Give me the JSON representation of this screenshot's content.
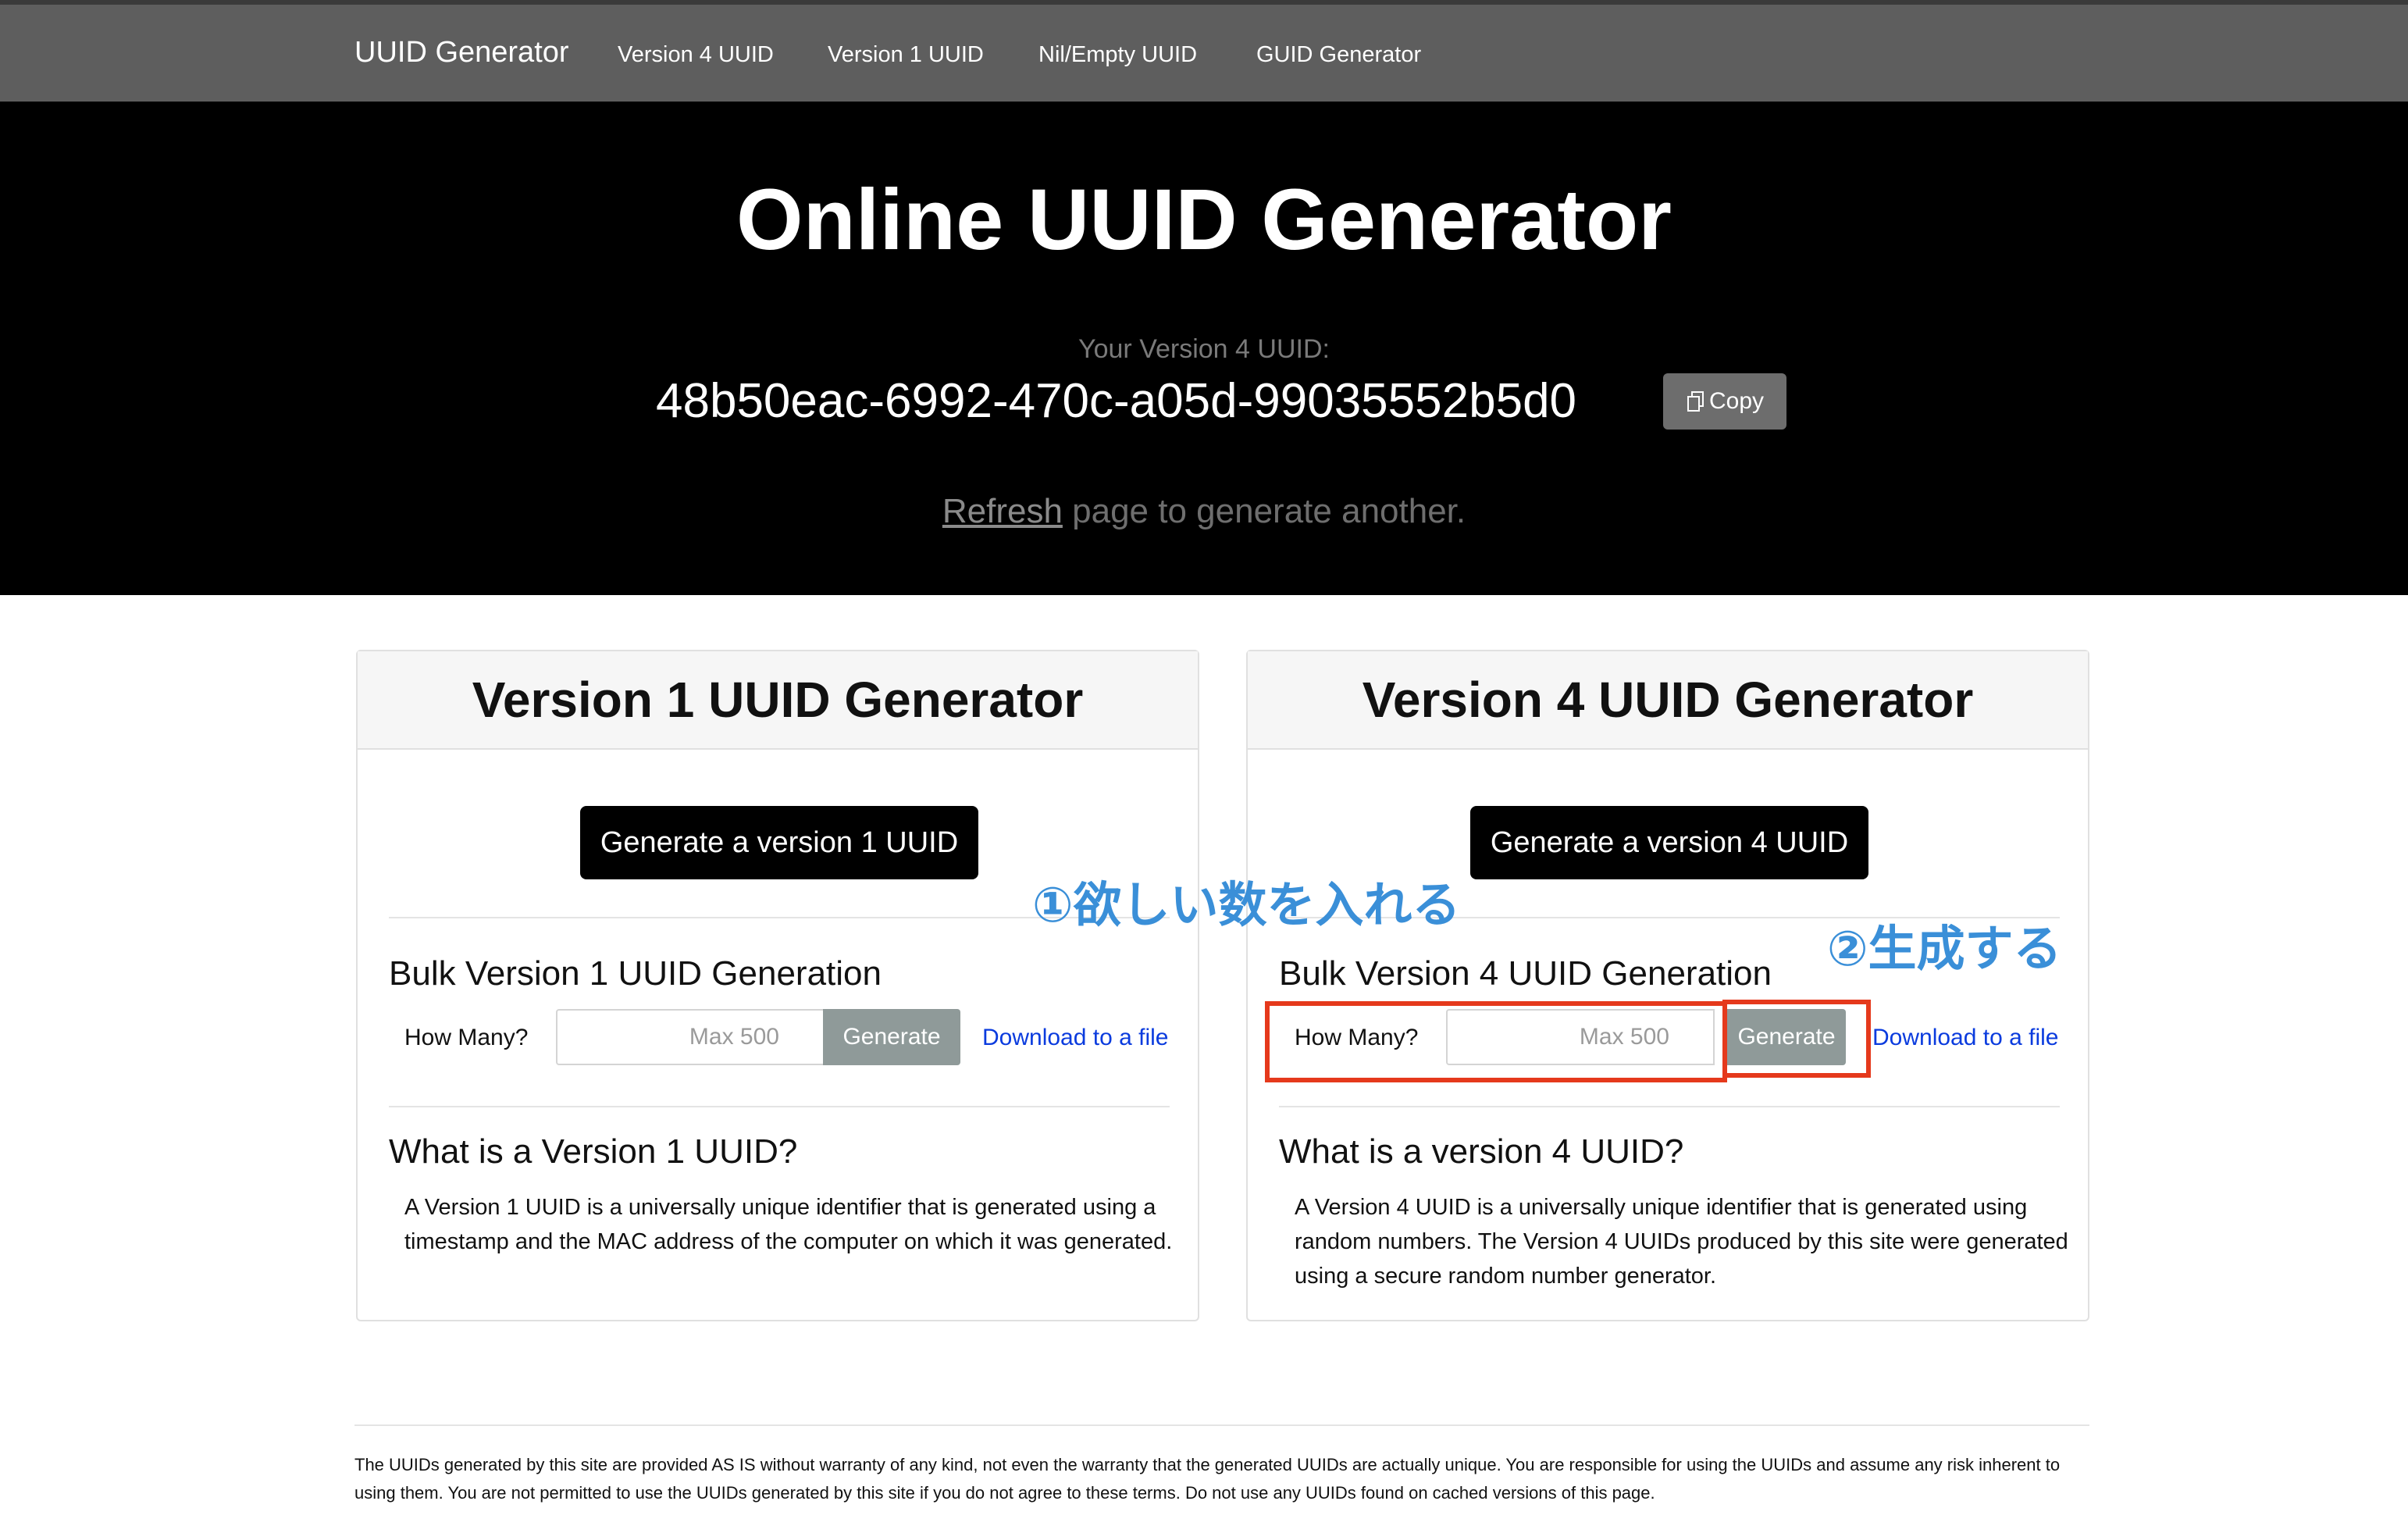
{
  "navbar": {
    "brand": "UUID Generator",
    "links": [
      "Version 4 UUID",
      "Version 1 UUID",
      "Nil/Empty UUID",
      "GUID Generator"
    ]
  },
  "hero": {
    "title": "Online UUID Generator",
    "uuid_label": "Your Version 4 UUID:",
    "uuid_value": "48b50eac-6992-470c-a05d-99035552b5d0",
    "copy_label": "Copy",
    "refresh_link": "Refresh",
    "refresh_text": " page to generate another."
  },
  "cards": [
    {
      "title": "Version 1 UUID Generator",
      "generate_label": "Generate a version 1 UUID",
      "bulk_title": "Bulk Version 1 UUID Generation",
      "how_many_label": "How Many?",
      "input_placeholder": "Max 500",
      "bulk_generate_label": "Generate",
      "download_label": "Download to a file",
      "what_title": "What is a Version 1 UUID?",
      "what_text": "A Version 1 UUID is a universally unique identifier that is generated using a timestamp and the MAC address of the computer on which it was generated."
    },
    {
      "title": "Version 4 UUID Generator",
      "generate_label": "Generate a version 4 UUID",
      "bulk_title": "Bulk Version 4 UUID Generation",
      "how_many_label": "How Many?",
      "input_placeholder": "Max 500",
      "bulk_generate_label": "Generate",
      "download_label": "Download to a file",
      "what_title": "What is a version 4 UUID?",
      "what_text": "A Version 4 UUID is a universally unique identifier that is generated using random numbers. The Version 4 UUIDs produced by this site were generated using a secure random number generator."
    }
  ],
  "annotations": {
    "step1": "①欲しい数を入れる",
    "step2": "②生成する",
    "box_color": "#e5391c",
    "text_color": "#3a8fd8"
  },
  "footer": {
    "text": "The UUIDs generated by this site are provided AS IS without warranty of any kind, not even the warranty that the generated UUIDs are actually unique. You are responsible for using the UUIDs and assume any risk inherent to using them. You are not permitted to use the UUIDs generated by this site if you do not agree to these terms. Do not use any UUIDs found on cached versions of this page."
  }
}
